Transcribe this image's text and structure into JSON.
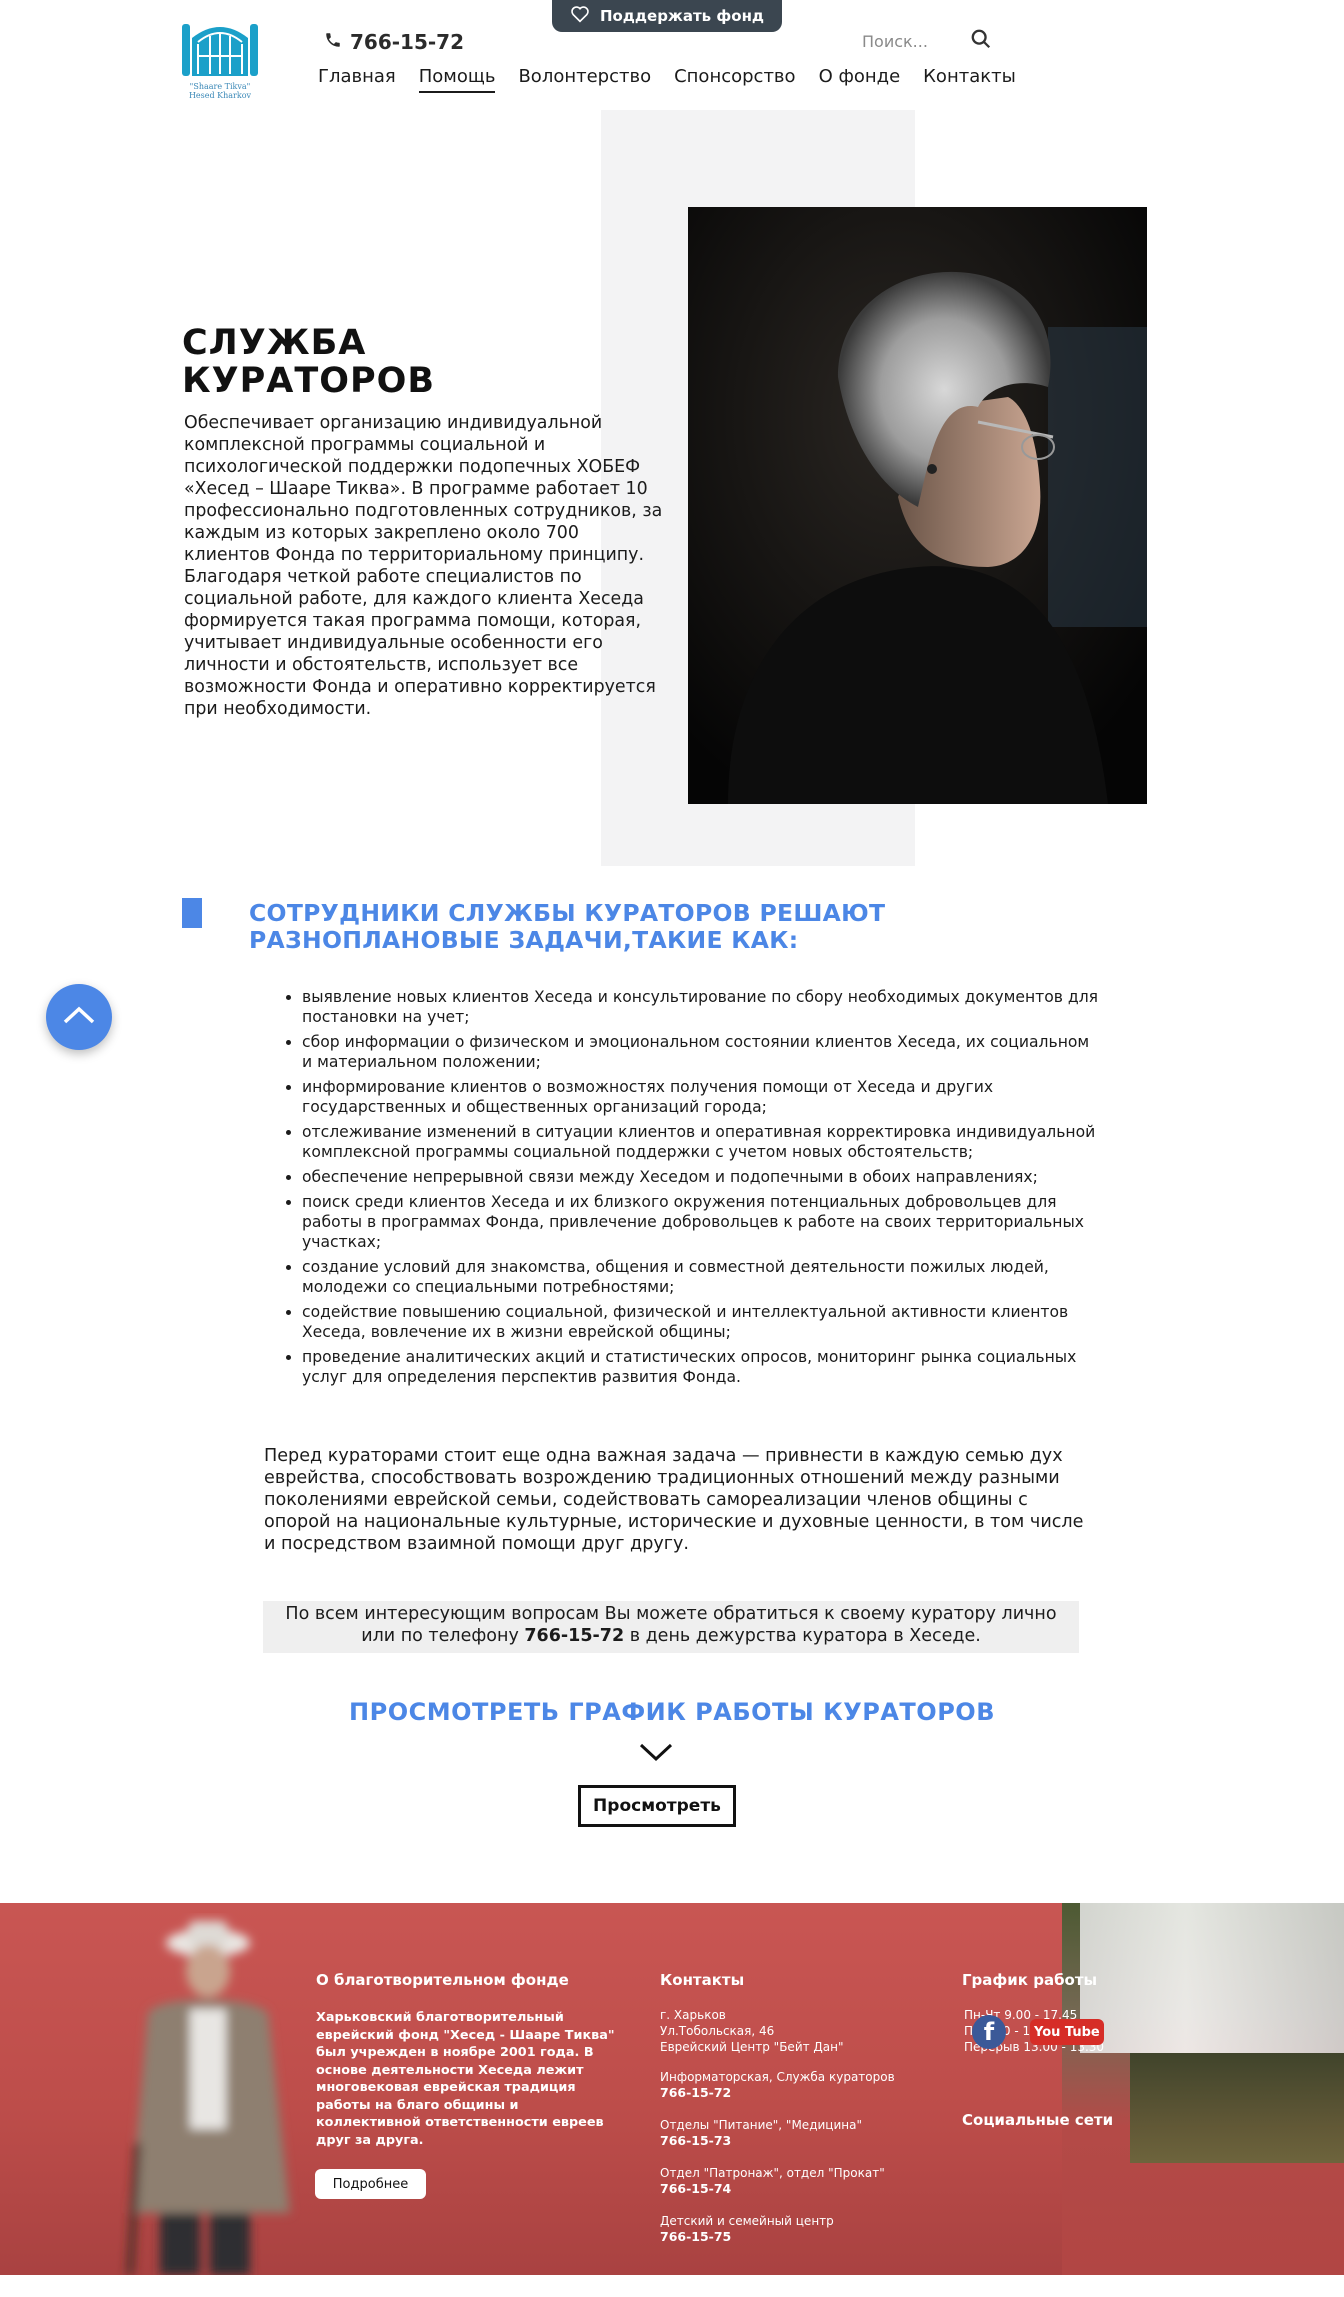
{
  "header": {
    "logo_caption": "\"Shaare Tikva\" Hesed Kharkov",
    "phone": "766-15-72",
    "support_button": "Поддержать фонд",
    "search_placeholder": "Поиск...",
    "nav": [
      "Главная",
      "Помощь",
      "Волонтерство",
      "Спонсорство",
      "О фонде",
      "Контакты"
    ],
    "active_nav": "Помощь"
  },
  "hero": {
    "title_line1": "СЛУЖБА",
    "title_line2": "КУРАТОРОВ",
    "intro": "Обеспечивает организацию индивидуальной комплексной программы социальной и психологической поддержки подопечных ХОБЕФ «Хесед – Шааре Тиква». В программе работает 10 профессионально подготовленных сотрудников, за каждым из которых закреплено около 700 клиентов Фонда по территориальному принципу. Благодаря четкой работе специалистов по социальной работе, для каждого клиента Хеседа формируется такая программа помощи, которая, учитывает индивидуальные особенности его личности и обстоятельств, использует все возможности Фонда и оперативно корректируется при необходимости."
  },
  "tasks": {
    "heading_line1": "СОТРУДНИКИ СЛУЖБЫ КУРАТОРОВ РЕШАЮТ",
    "heading_line2": "РАЗНОПЛАНОВЫЕ ЗАДАЧИ,ТАКИЕ КАК:",
    "items": [
      "выявление новых клиентов Хеседа и консультирование по сбору необходимых документов для постановки на учет;",
      "сбор информации о физическом и эмоциональном состоянии клиентов Хеседа, их социальном и материальном положении;",
      "информирование клиентов о возможностях получения помощи от Хеседа и других государственных и общественных организаций города;",
      "отслеживание изменений в ситуации клиентов и оперативная корректировка индивидуальной комплексной программы социальной поддержки с учетом новых обстоятельств;",
      "обеспечение непрерывной связи между Хеседом и подопечными в обоих направлениях;",
      "поиск среди клиентов Хеседа и их близкого окружения потенциальных добровольцев для работы в программах Фонда, привлечение добровольцев к работе на своих территориальных участках;",
      "создание условий для знакомства, общения и совместной деятельности пожилых людей, молодежи со специальными потребностями;",
      "содействие повышению социальной, физической и интеллектуальной активности клиентов Хеседа, вовлечение их в жизни еврейской общины;",
      "проведение аналитических акций и статистических опросов, мониторинг рынка социальных услуг для определения перспектив развития Фонда."
    ],
    "extra": "Перед кураторами стоит еще одна важная задача — привнести в каждую семью дух еврейства, способствовать возрождению традиционных отношений между разными поколениями еврейской семьи, содействовать самореализации членов общины с опорой на национальные культурные, исторические и духовные ценности, в том числе и посредством взаимной помощи друг другу.",
    "contact_line1": "По всем интересующим вопросам Вы можете обратиться к своему куратору лично",
    "contact_line2_pre": "или по телефону ",
    "contact_phone": "766-15-72",
    "contact_line2_post": " в день дежурства куратора в Хеседе.",
    "schedule_heading": "ПРОСМОТРЕТЬ ГРАФИК РАБОТЫ КУРАТОРОВ",
    "view_button": "Просмотреть"
  },
  "footer": {
    "about_heading": "О благотворительном фонде",
    "about_text": "Харьковский благотворительный еврейский фонд \"Хесед - Шааре Тиква\" был учрежден в ноябре 2001 года. В основе деятельности Хеседа лежит многовековая еврейская традиция работы на благо общины и коллективной ответственности евреев друг за друга.",
    "about_button": "Подробнее",
    "contacts_heading": "Контакты",
    "address": [
      "г. Харьков",
      "Ул.Тобольская, 46",
      "Еврейский Центр \"Бейт Дан\""
    ],
    "departments": [
      {
        "name": "Информаторская, Служба кураторов",
        "phone": "766-15-72"
      },
      {
        "name": "Отделы \"Питание\", \"Медицина\"",
        "phone": "766-15-73"
      },
      {
        "name": "Отдел \"Патронаж\", отдел \"Прокат\"",
        "phone": "766-15-74"
      },
      {
        "name": "Детский и семейный центр",
        "phone": "766-15-75"
      }
    ],
    "schedule_heading": "График работы",
    "schedule_lines": [
      "Пн-Чт 9.00 - 17.45",
      "Пт 9.00 - 16.30",
      "Перерыв 13.00 - 13.30"
    ],
    "social_heading": "Социальные сети",
    "social_icons": [
      "facebook-icon",
      "youtube-icon"
    ],
    "youtube_text": "You Tube"
  },
  "colors": {
    "accent_blue": "#4c87e6",
    "dark_button": "#3b4650",
    "footer_red": "#c95653",
    "logo_teal": "#1ba0c9"
  }
}
